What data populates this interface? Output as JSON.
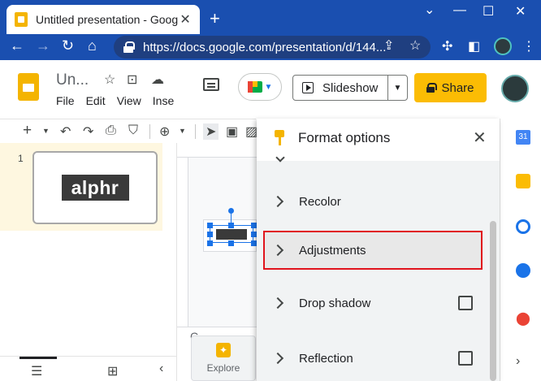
{
  "browser": {
    "tab_title": "Untitled presentation - Google Sl",
    "tab_close": "✕",
    "new_tab": "+",
    "url": "https://docs.google.com/presentation/d/144...",
    "window_controls": {
      "minimize": "—",
      "maximize": "☐",
      "close": "✕"
    }
  },
  "app": {
    "doc_title": "Un...",
    "menu": [
      "File",
      "Edit",
      "View",
      "Inse"
    ],
    "slideshow_label": "Slideshow",
    "share_label": "Share"
  },
  "filmstrip": {
    "slides": [
      {
        "number": "1",
        "logo_text": "alphr"
      }
    ]
  },
  "canvas": {
    "speaker_notes_peek": "C"
  },
  "explore": {
    "label": "Explore"
  },
  "format_panel": {
    "title": "Format options",
    "close": "✕",
    "sections": [
      {
        "label": "Recolor",
        "has_checkbox": false
      },
      {
        "label": "Adjustments",
        "has_checkbox": false,
        "highlighted": true
      },
      {
        "label": "Drop shadow",
        "has_checkbox": true,
        "checked": false
      },
      {
        "label": "Reflection",
        "has_checkbox": true,
        "checked": false
      }
    ]
  },
  "colors": {
    "chrome_blue": "#1a4fb0",
    "share_yellow": "#fbbc04",
    "highlight_red": "#e0131c",
    "slides_yellow": "#f4b400"
  }
}
